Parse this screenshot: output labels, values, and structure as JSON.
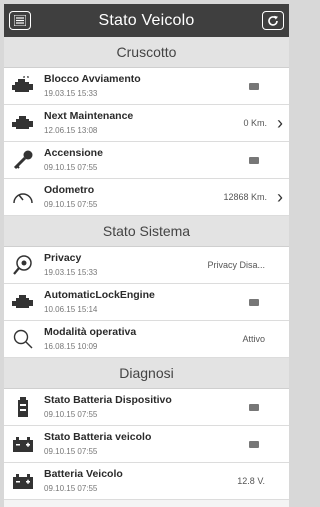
{
  "header": {
    "title": "Stato Veicolo",
    "menu_icon": "list-menu-icon",
    "refresh_icon": "refresh-icon"
  },
  "sections": [
    {
      "title": "Cruscotto",
      "rows": [
        {
          "name": "Blocco Avviamento",
          "date": "19.03.15 15:33",
          "icon": "engine-lock-icon",
          "value_type": "box",
          "value": "",
          "arrow": false
        },
        {
          "name": "Next Maintenance",
          "date": "12.06.15 13:08",
          "icon": "engine-icon",
          "value_type": "text",
          "value": "0 Km.",
          "arrow": true
        },
        {
          "name": "Accensione",
          "date": "09.10.15 07:55",
          "icon": "ignition-key-icon",
          "value_type": "box",
          "value": "",
          "arrow": false
        },
        {
          "name": "Odometro",
          "date": "09.10.15 07:55",
          "icon": "odometer-icon",
          "value_type": "text",
          "value": "12868 Km.",
          "arrow": true
        }
      ]
    },
    {
      "title": "Stato Sistema",
      "rows": [
        {
          "name": "Privacy",
          "date": "19.03.15 15:33",
          "icon": "privacy-eye-icon",
          "value_type": "text",
          "value": "Privacy Disa...",
          "arrow": false
        },
        {
          "name": "AutomaticLockEngine",
          "date": "10.06.15 15:14",
          "icon": "engine-icon",
          "value_type": "box",
          "value": "",
          "arrow": false
        },
        {
          "name": "Modalità operativa",
          "date": "16.08.15 10:09",
          "icon": "magnifier-icon",
          "value_type": "text",
          "value": "Attivo",
          "arrow": false
        }
      ]
    },
    {
      "title": "Diagnosi",
      "rows": [
        {
          "name": "Stato Batteria Dispositivo",
          "date": "09.10.15 07:55",
          "icon": "device-battery-icon",
          "value_type": "box",
          "value": "",
          "arrow": false
        },
        {
          "name": "Stato Batteria veicolo",
          "date": "09.10.15 07:55",
          "icon": "car-battery-icon",
          "value_type": "box",
          "value": "",
          "arrow": false
        },
        {
          "name": "Batteria Veicolo",
          "date": "09.10.15 07:55",
          "icon": "car-battery-icon",
          "value_type": "text",
          "value": "12.8 V.",
          "arrow": false
        }
      ]
    }
  ],
  "colors": {
    "header_bg": "#3f3f3f",
    "section_bg": "#e3e3e3",
    "row_bg": "#ffffff"
  }
}
